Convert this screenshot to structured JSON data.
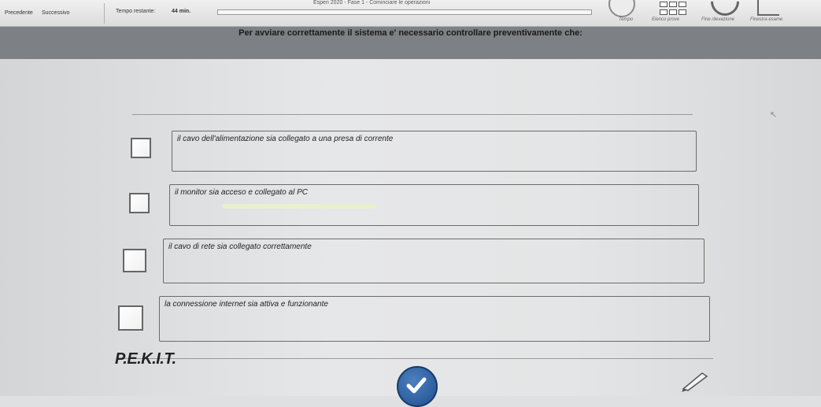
{
  "toolbar": {
    "prev_label": "Precedente",
    "next_label": "Successivo",
    "time_label": "Tempo restante:",
    "time_value": "44 min.",
    "exam_title": "Esperi 2020 - Fase 1 - Cominciare le operazioni",
    "labels": {
      "tempo": "Tempo",
      "elenco": "Elenco prove",
      "fine": "Fine rilevazione",
      "finestra": "Finestra esame"
    }
  },
  "question": {
    "text": "Per avviare correttamente il sistema e' necessario controllare preventivamente che:"
  },
  "answers": [
    {
      "text": "il cavo dell'alimentazione sia collegato a una presa di corrente"
    },
    {
      "text": "il monitor sia acceso e collegato al PC"
    },
    {
      "text": "il cavo di rete sia collegato correttamente"
    },
    {
      "text": "la connessione internet sia attiva e funzionante"
    }
  ],
  "footer": {
    "logo": "P.E.K.I.T."
  },
  "icons": {
    "confirm": "check-icon",
    "pen": "pen-icon",
    "cursor": "cursor-icon"
  },
  "colors": {
    "question_bar": "#7d8084",
    "confirm_button": "#2d62a8"
  }
}
